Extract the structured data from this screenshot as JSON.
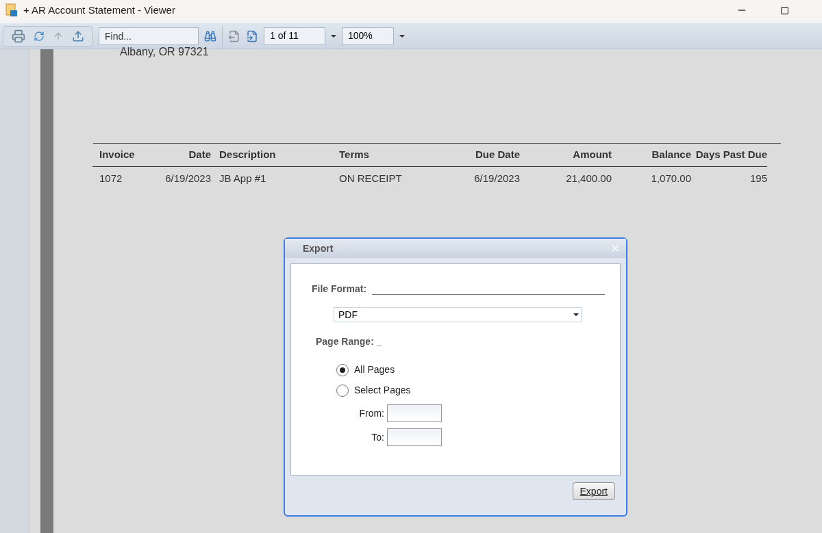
{
  "window": {
    "title": "+ AR Account Statement - Viewer"
  },
  "toolbar": {
    "find": {
      "placeholder": "Find..."
    },
    "page": "1 of 11",
    "zoom": "100%"
  },
  "document": {
    "address_line": "Albany, OR  97321",
    "table": {
      "columns": [
        "Invoice",
        "Date",
        "Description",
        "Terms",
        "Due Date",
        "Amount",
        "Balance",
        "Days Past Due"
      ],
      "rows": [
        [
          "1072",
          "6/19/2023",
          "JB App #1",
          "ON RECEIPT",
          "6/19/2023",
          "21,400.00",
          "1,070.00",
          "195"
        ]
      ]
    }
  },
  "dialog": {
    "title": "Export",
    "file_format_label": "File Format:",
    "format": "PDF",
    "page_range_label": "Page Range: _",
    "options": [
      {
        "label": "All Pages",
        "selected": true
      },
      {
        "label": "Select Pages",
        "selected": false
      }
    ],
    "from_label": "From:",
    "to_label": "To:",
    "button": "Export"
  }
}
